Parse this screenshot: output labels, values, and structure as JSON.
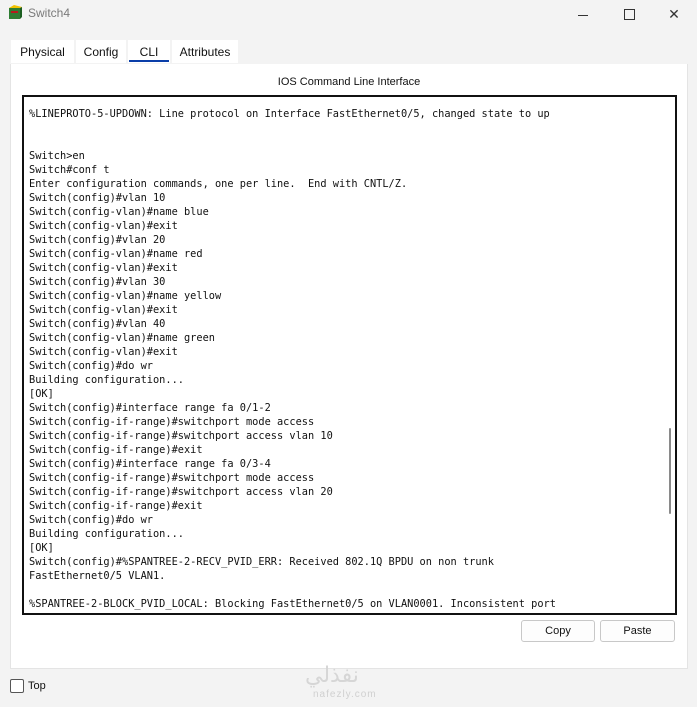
{
  "window": {
    "title": "Switch4",
    "minimize_icon": "minimize-icon",
    "maximize_icon": "maximize-icon",
    "close_icon": "close-icon",
    "close_glyph": "✕"
  },
  "tabs": [
    {
      "label": "Physical",
      "active": false
    },
    {
      "label": "Config",
      "active": false
    },
    {
      "label": "CLI",
      "active": true
    },
    {
      "label": "Attributes",
      "active": false
    }
  ],
  "cli": {
    "heading": "IOS Command Line Interface",
    "lines": [
      "%LINEPROTO-5-UPDOWN: Line protocol on Interface FastEthernet0/5, changed state to up",
      "",
      "",
      "Switch>en",
      "Switch#conf t",
      "Enter configuration commands, one per line.  End with CNTL/Z.",
      "Switch(config)#vlan 10",
      "Switch(config-vlan)#name blue",
      "Switch(config-vlan)#exit",
      "Switch(config)#vlan 20",
      "Switch(config-vlan)#name red",
      "Switch(config-vlan)#exit",
      "Switch(config)#vlan 30",
      "Switch(config-vlan)#name yellow",
      "Switch(config-vlan)#exit",
      "Switch(config)#vlan 40",
      "Switch(config-vlan)#name green",
      "Switch(config-vlan)#exit",
      "Switch(config)#do wr",
      "Building configuration...",
      "[OK]",
      "Switch(config)#interface range fa 0/1-2",
      "Switch(config-if-range)#switchport mode access",
      "Switch(config-if-range)#switchport access vlan 10",
      "Switch(config-if-range)#exit",
      "Switch(config)#interface range fa 0/3-4",
      "Switch(config-if-range)#switchport mode access",
      "Switch(config-if-range)#switchport access vlan 20",
      "Switch(config-if-range)#exit",
      "Switch(config)#do wr",
      "Building configuration...",
      "[OK]",
      "Switch(config)#%SPANTREE-2-RECV_PVID_ERR: Received 802.1Q BPDU on non trunk",
      "FastEthernet0/5 VLAN1.",
      "",
      "%SPANTREE-2-BLOCK_PVID_LOCAL: Blocking FastEthernet0/5 on VLAN0001. Inconsistent port"
    ],
    "scroll_position": 0.72
  },
  "buttons": {
    "copy": "Copy",
    "paste": "Paste"
  },
  "footer": {
    "top_label": "Top",
    "top_checked": false
  },
  "watermark": {
    "arabic": "نفذلي",
    "latin": "nafezly.com"
  },
  "colors": {
    "active_tab_underline": "#0a3ea8",
    "terminal_border": "#111111"
  }
}
